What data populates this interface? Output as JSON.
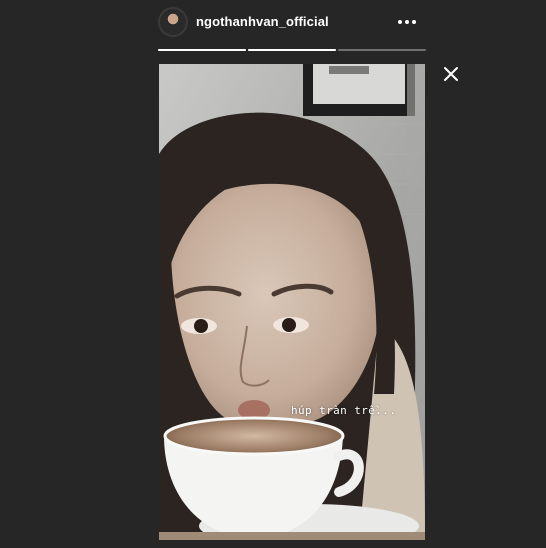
{
  "story": {
    "username": "ngothanhvan_official",
    "caption": "húp tràn trề...",
    "segments": [
      {
        "progress": 1.0
      },
      {
        "progress": 1.0
      },
      {
        "progress": 0.0
      }
    ]
  },
  "icons": {
    "more": "more-horizontal-icon",
    "close": "close-icon"
  },
  "colors": {
    "background": "#262626",
    "text": "#ffffff"
  }
}
